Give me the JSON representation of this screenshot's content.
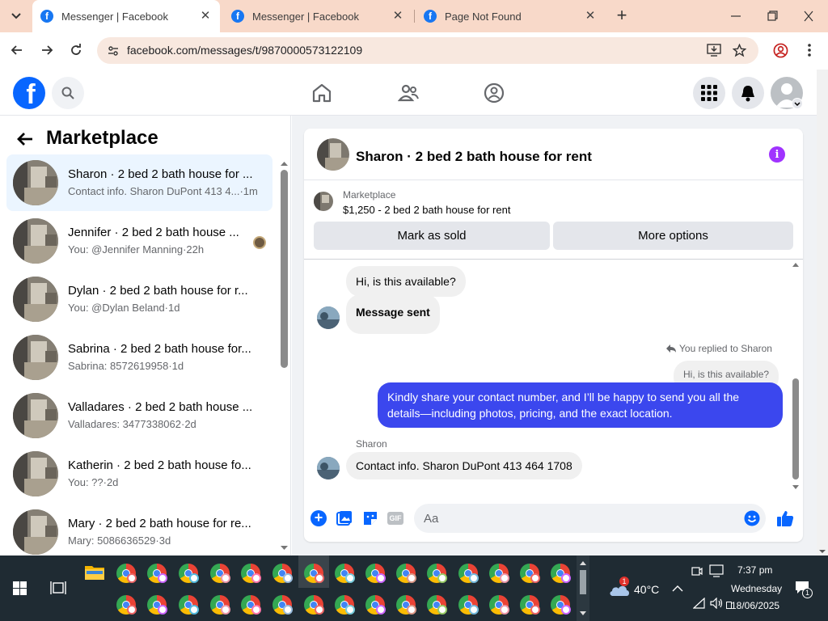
{
  "browser": {
    "tabs": [
      {
        "title": "Messenger | Facebook",
        "active": true
      },
      {
        "title": "Messenger | Facebook",
        "active": false
      },
      {
        "title": "Page Not Found",
        "active": false
      }
    ],
    "url": "facebook.com/messages/t/9870000573122109"
  },
  "sidebar": {
    "title": "Marketplace",
    "conversations": [
      {
        "name": "Sharon · 2 bed 2 bath house for ...",
        "preview": "Contact info. Sharon DuPont 413 4...·1m",
        "selected": true
      },
      {
        "name": "Jennifer · 2 bed 2 bath house ...",
        "preview": "You: @Jennifer Manning·22h",
        "selected": false
      },
      {
        "name": "Dylan · 2 bed 2 bath house for r...",
        "preview": "You: @Dylan Beland·1d",
        "selected": false
      },
      {
        "name": "Sabrina · 2 bed 2 bath house for...",
        "preview": "Sabrina: 8572619958·1d",
        "selected": false
      },
      {
        "name": "Valladares · 2 bed 2 bath house ...",
        "preview": "Valladares: 3477338062·2d",
        "selected": false
      },
      {
        "name": "Katherin · 2 bed 2 bath house fo...",
        "preview": "You: ??·2d",
        "selected": false
      },
      {
        "name": "Mary · 2 bed 2 bath house for re...",
        "preview": "Mary: 5086636529·3d",
        "selected": false
      }
    ]
  },
  "chat": {
    "title": "Sharon · 2 bed 2 bath house for rent",
    "listing": {
      "label": "Marketplace",
      "detail": "$1,250 - 2 bed 2 bath house for rent"
    },
    "mark_sold_label": "Mark as sold",
    "more_options_label": "More options",
    "messages": {
      "m1": "Hi, is this available?",
      "m2": "Message sent",
      "reply_note": "You replied to Sharon",
      "quoted": "Hi, is this available?",
      "m3": "Kindly share your contact number, and I’ll be happy to send you all the details—including photos, pricing, and the exact location.",
      "sender": "Sharon",
      "m4": "Contact info. Sharon DuPont 413 464 1708"
    },
    "composer_placeholder": "Aa",
    "gif_label": "GIF"
  },
  "taskbar": {
    "weather_badge": "1",
    "temperature": "40°C",
    "time": "7:37 pm",
    "day": "Wednesday",
    "date": "18/06/2025",
    "notification_count": "1"
  },
  "colors": {
    "facebook_blue": "#1877f2",
    "outgoing_bubble": "#3b47ee",
    "info_purple": "#a033ff",
    "taskbar": "#1f2b33"
  }
}
